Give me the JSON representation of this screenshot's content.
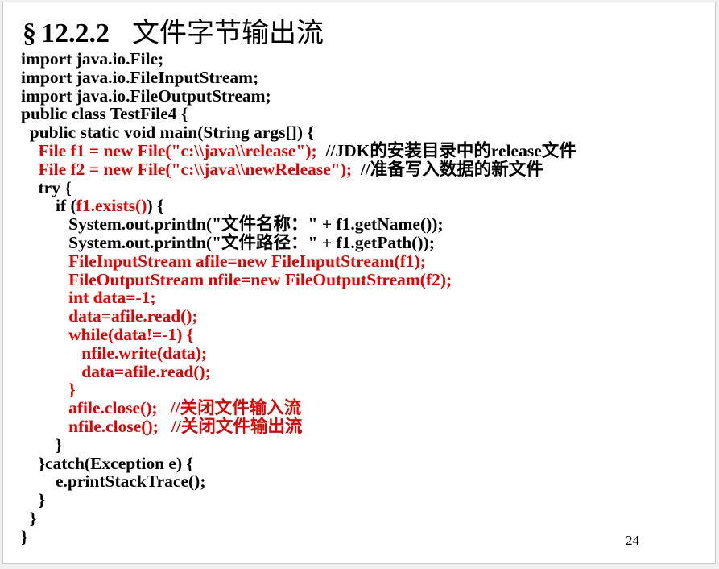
{
  "slide": {
    "title_mark": "§",
    "title_number": "12.2.2",
    "title_text": "文件字节输出流",
    "page_number": "24",
    "accent_color": "#e60000"
  },
  "code_lines": [
    [
      {
        "t": "import java.io.File;",
        "c": "black"
      }
    ],
    [
      {
        "t": "import java.io.FileInputStream;",
        "c": "black"
      }
    ],
    [
      {
        "t": "import java.io.FileOutputStream;",
        "c": "black"
      }
    ],
    [
      {
        "t": "public class TestFile4 {",
        "c": "black"
      }
    ],
    [
      {
        "t": "  public static void main(String args[]) {",
        "c": "black"
      }
    ],
    [
      {
        "t": "    File f1 = new File(\"c:\\\\java\\\\release\");",
        "c": "red"
      },
      {
        "t": "  //JDK的安装目录中的release文件",
        "c": "black"
      }
    ],
    [
      {
        "t": "    File f2 = new File(\"c:\\\\java\\\\newRelease\");",
        "c": "red"
      },
      {
        "t": "  //准备写入数据的新文件",
        "c": "black"
      }
    ],
    [
      {
        "t": "    try {",
        "c": "black"
      }
    ],
    [
      {
        "t": "        if (",
        "c": "black"
      },
      {
        "t": "f1.exists()",
        "c": "red"
      },
      {
        "t": ") {",
        "c": "black"
      }
    ],
    [
      {
        "t": "           System.out.println(\"文件名称：\" + f1.getName());",
        "c": "black"
      }
    ],
    [
      {
        "t": "           System.out.println(\"文件路径：\" + f1.getPath());",
        "c": "black"
      }
    ],
    [
      {
        "t": "           FileInputStream afile=new FileInputStream(f1);",
        "c": "red"
      }
    ],
    [
      {
        "t": "           FileOutputStream nfile=new FileOutputStream(f2);",
        "c": "red"
      }
    ],
    [
      {
        "t": "           int data=-1;",
        "c": "red"
      }
    ],
    [
      {
        "t": "           data=afile.read();",
        "c": "red"
      }
    ],
    [
      {
        "t": "           while(data!=-1) {",
        "c": "red"
      }
    ],
    [
      {
        "t": "              nfile.write(data);",
        "c": "red"
      }
    ],
    [
      {
        "t": "              data=afile.read();",
        "c": "red"
      }
    ],
    [
      {
        "t": "           }",
        "c": "red"
      }
    ],
    [
      {
        "t": "           afile.close();   //关闭文件输入流",
        "c": "red"
      }
    ],
    [
      {
        "t": "           nfile.close();   //关闭文件输出流",
        "c": "red"
      }
    ],
    [
      {
        "t": "        }",
        "c": "black"
      }
    ],
    [
      {
        "t": "    }catch(Exception e) {",
        "c": "black"
      }
    ],
    [
      {
        "t": "        e.printStackTrace();",
        "c": "black"
      }
    ],
    [
      {
        "t": "    }",
        "c": "black"
      }
    ],
    [
      {
        "t": "  }",
        "c": "black"
      }
    ],
    [
      {
        "t": "}",
        "c": "black"
      }
    ]
  ]
}
